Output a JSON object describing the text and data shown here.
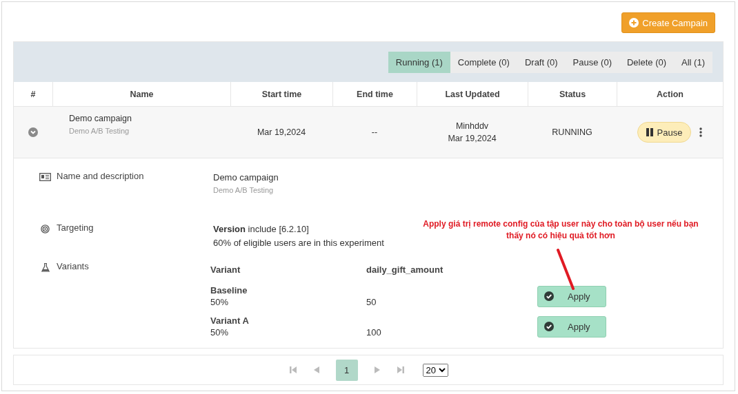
{
  "create_button": {
    "label": "Create Campain"
  },
  "filter_tabs": [
    {
      "label": "Running (1)",
      "selected": true
    },
    {
      "label": "Complete (0)",
      "selected": false
    },
    {
      "label": "Draft (0)",
      "selected": false
    },
    {
      "label": "Pause (0)",
      "selected": false
    },
    {
      "label": "Delete (0)",
      "selected": false
    },
    {
      "label": "All (1)",
      "selected": false
    }
  ],
  "table": {
    "columns": [
      "#",
      "Name",
      "Start time",
      "End time",
      "Last Updated",
      "Status",
      "Action"
    ],
    "rows": [
      {
        "expanded": true,
        "name": "Demo campaign",
        "description": "Demo A/B Testing",
        "start_time": "Mar 19,2024",
        "end_time": "--",
        "updated_by": "Minhddv",
        "updated_at": "Mar 19,2024",
        "status": "RUNNING",
        "action": "Pause",
        "details": {
          "name_section": {
            "label": "Name and description",
            "name": "Demo campaign",
            "description": "Demo A/B Testing"
          },
          "targeting": {
            "label": "Targeting",
            "rule": "**Version** include [6.2.10]",
            "audience": "60% of eligible users are in this experiment"
          },
          "variants": {
            "label": "Variants",
            "columns": [
              "Variant",
              "daily_gift_amount"
            ],
            "items": [
              {
                "name": "Baseline",
                "share": "50%",
                "value": "50",
                "button": "Apply"
              },
              {
                "name": "Variant A",
                "share": "50%",
                "value": "100",
                "button": "Apply"
              }
            ]
          }
        }
      }
    ]
  },
  "annotation": {
    "text": "Apply giá trị remote config của tập user này cho toàn bộ user nếu bạn thấy nó có hiệu quả tốt hơn"
  },
  "pagination": {
    "pages": [
      {
        "label": "1",
        "selected": true
      }
    ],
    "page_size": "20"
  }
}
